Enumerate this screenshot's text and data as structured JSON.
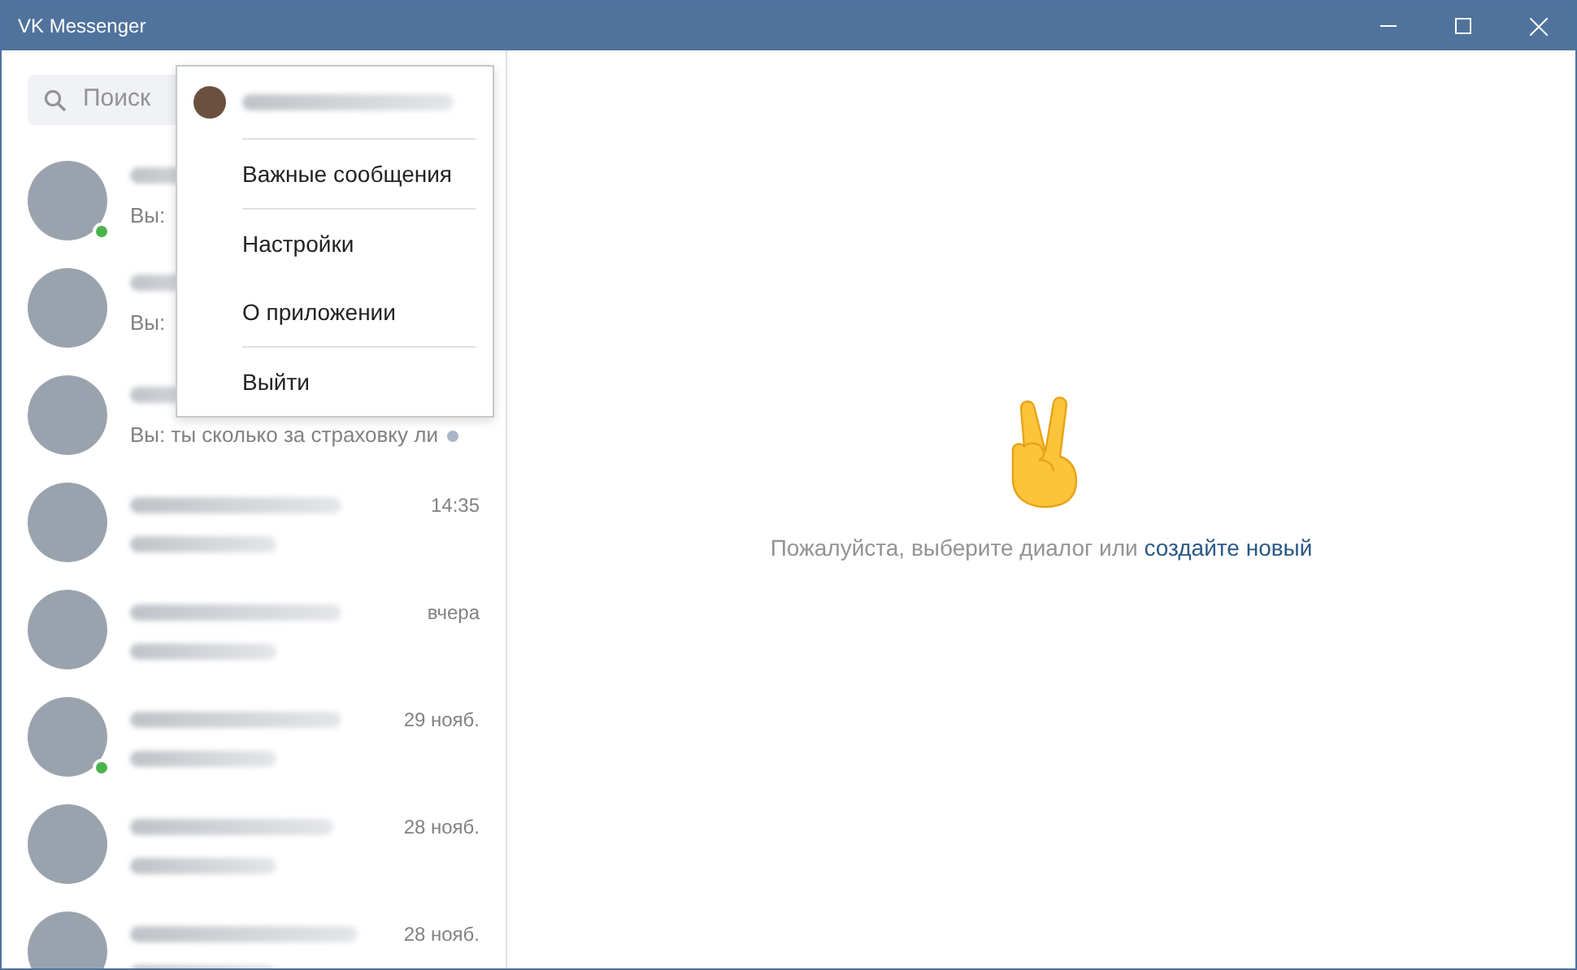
{
  "window": {
    "title": "VK Messenger"
  },
  "search": {
    "placeholder": "Поиск"
  },
  "dialogs": [
    {
      "preview": "Вы:",
      "online": true,
      "unread": false
    },
    {
      "preview": "Вы:",
      "online": false,
      "unread": false
    },
    {
      "preview": "Вы: ты сколько за страховку ли",
      "online": false,
      "unread": true
    },
    {
      "time": "14:35",
      "online": false,
      "unread": false
    },
    {
      "time": "вчера",
      "online": false,
      "unread": false
    },
    {
      "time": "29 нояб.",
      "online": true,
      "unread": false
    },
    {
      "time": "28 нояб.",
      "online": false,
      "unread": false
    },
    {
      "time": "28 нояб.",
      "online": false,
      "unread": false
    }
  ],
  "menu": {
    "groups": [
      [
        "Важные сообщения"
      ],
      [
        "Настройки",
        "О приложении"
      ],
      [
        "Выйти"
      ]
    ]
  },
  "empty_state": {
    "text": "Пожалуйста, выберите диалог или ",
    "link": "создайте новый"
  }
}
